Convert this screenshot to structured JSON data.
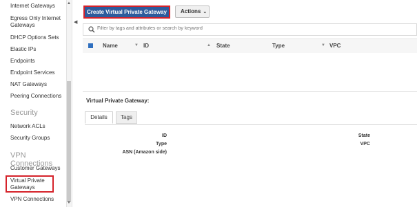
{
  "sidebar": {
    "items_top": [
      {
        "label": "Internet Gateways"
      },
      {
        "label": "Egress Only Internet Gateways"
      },
      {
        "label": "DHCP Options Sets"
      },
      {
        "label": "Elastic IPs"
      },
      {
        "label": "Endpoints"
      },
      {
        "label": "Endpoint Services"
      },
      {
        "label": "NAT Gateways"
      },
      {
        "label": "Peering Connections"
      }
    ],
    "security_heading": "Security",
    "security_items": [
      {
        "label": "Network ACLs"
      },
      {
        "label": "Security Groups"
      }
    ],
    "vpn_heading": "VPN Connections",
    "vpn_items": [
      {
        "label": "Customer Gateways"
      },
      {
        "label": "Virtual Private Gateways"
      },
      {
        "label": "VPN Connections"
      }
    ]
  },
  "toolbar": {
    "create_label": "Create Virtual Private Gateway",
    "actions_label": "Actions"
  },
  "filter": {
    "placeholder": "Filter by tags and attributes or search by keyword"
  },
  "table": {
    "columns": [
      "Name",
      "ID",
      "State",
      "Type",
      "VPC"
    ],
    "rows": []
  },
  "details": {
    "title": "Virtual Private Gateway:",
    "tabs": [
      "Details",
      "Tags"
    ],
    "active_tab": "Details",
    "left_fields": [
      "ID",
      "Type",
      "ASN (Amazon side)"
    ],
    "right_fields": [
      "State",
      "VPC"
    ]
  },
  "colors": {
    "primary_button": "#2d5b9c",
    "highlight": "#d5222a",
    "checkbox": "#2f6fbf"
  }
}
